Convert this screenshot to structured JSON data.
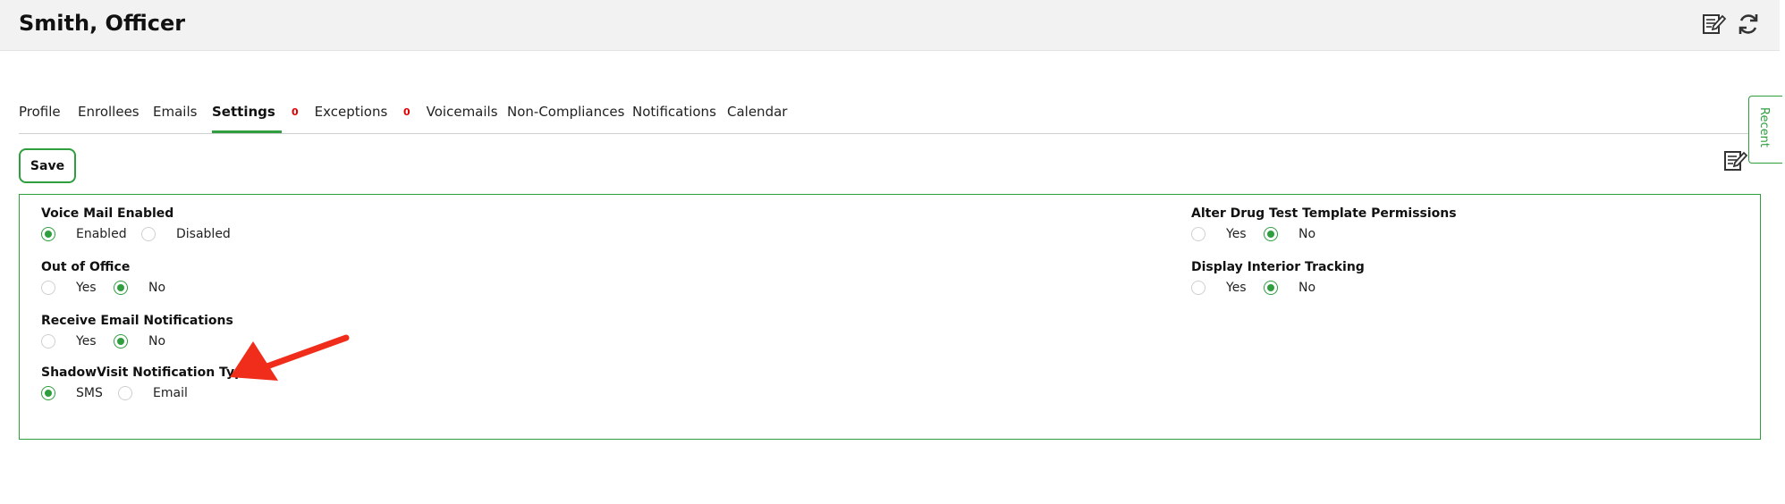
{
  "header": {
    "title": "Smith, Officer",
    "icons": [
      "edit-notes-icon",
      "refresh-icon"
    ]
  },
  "tabs": [
    {
      "label": "Profile",
      "active": false
    },
    {
      "label": "Enrollees",
      "active": false
    },
    {
      "label": "Emails",
      "active": false
    },
    {
      "label": "Settings",
      "active": true
    },
    {
      "label": "Exceptions",
      "badge": "0",
      "active": false
    },
    {
      "label": "Voicemails",
      "badge": "0",
      "active": false
    },
    {
      "label": "Non-Compliances",
      "active": false
    },
    {
      "label": "Notifications",
      "active": false
    },
    {
      "label": "Calendar",
      "active": false
    }
  ],
  "recent_tab_label": "Recent",
  "toolbar": {
    "save_label": "Save"
  },
  "settings": {
    "voice_mail": {
      "label": "Voice Mail Enabled",
      "options": [
        "Enabled",
        "Disabled"
      ],
      "selected": "Enabled"
    },
    "out_of_office": {
      "label": "Out of Office",
      "options": [
        "Yes",
        "No"
      ],
      "selected": "No"
    },
    "email_notifications": {
      "label": "Receive Email Notifications",
      "options": [
        "Yes",
        "No"
      ],
      "selected": "No"
    },
    "shadowvisit": {
      "label": "ShadowVisit Notification Type",
      "options": [
        "SMS",
        "Email"
      ],
      "selected": "SMS"
    },
    "drug_test": {
      "label": "Alter Drug Test Template Permissions",
      "options": [
        "Yes",
        "No"
      ],
      "selected": "No"
    },
    "interior_tracking": {
      "label": "Display Interior Tracking",
      "options": [
        "Yes",
        "No"
      ],
      "selected": "No"
    }
  },
  "colors": {
    "accent": "#2e9e3e",
    "badge": "#e10000",
    "annotation_arrow": "#f02d1a"
  }
}
